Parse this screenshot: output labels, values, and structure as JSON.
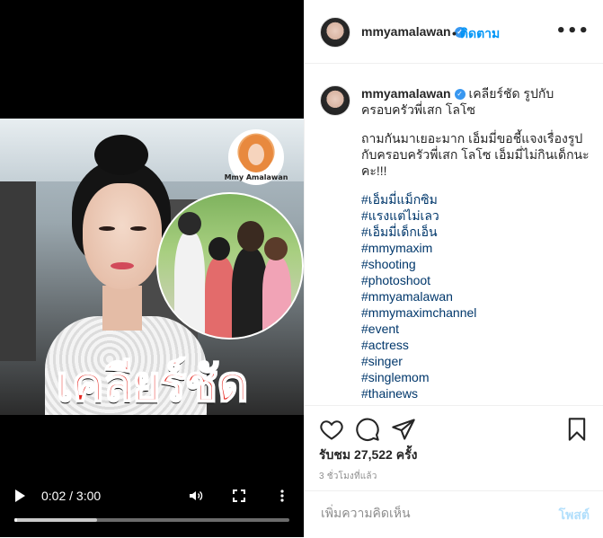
{
  "video": {
    "headline": "เคลียร์ชัด",
    "watermark": "Mmy Amalawan",
    "time": "0:02 / 3:00",
    "progress_played": 0.01,
    "progress_buffered": 0.3
  },
  "header": {
    "username": "mmyamalawan",
    "separator": "•",
    "follow_label": "ติดตาม",
    "more_label": "•••"
  },
  "caption": {
    "username": "mmyamalawan",
    "title": "เคลียร์ชัด รูปกับครอบครัวพี่เสก โลโซ",
    "body": "ถามกันมาเยอะมาก เอ็มมี่ขอชี้แจงเรื่องรูปกับครอบครัวพี่เสก โลโซ เอ็มมี่ไม่กินเด็กนะคะ!!!",
    "hashtags": [
      "#เอ็มมี่แม็กซิม",
      "#แรงแต่ไม่เลว",
      "#เอ็มมี่เด็กเอ็น",
      "#mmymaxim",
      "#shooting",
      "#photoshoot",
      "#mmyamalawan",
      "#mmymaximchannel",
      "#event",
      "#actress",
      "#singer",
      "#singlemom",
      "#thainews"
    ]
  },
  "stats": {
    "views": "รับชม 27,522 ครั้ง",
    "posted": "3 ชั่วโมงที่แล้ว"
  },
  "comment_box": {
    "placeholder": "เพิ่มความคิดเห็น",
    "post_label": "โพสต์"
  },
  "colors": {
    "headline": "#e6261f",
    "link": "#0095f6",
    "hashtag": "#00376b",
    "verified": "#3897f0"
  }
}
